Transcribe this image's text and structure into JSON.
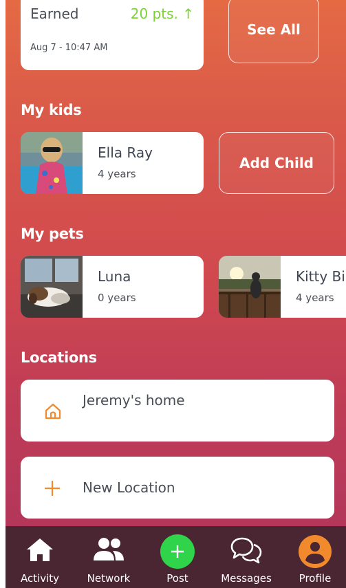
{
  "points": {
    "label": "Earned",
    "value": "20 pts. ↑",
    "timestamp": "Aug 7 - 10:47 AM",
    "see_all": "See All",
    "value_color": "#7ad234"
  },
  "kids": {
    "title": "My kids",
    "items": [
      {
        "name": "Ella Ray",
        "age": "4 years",
        "photo": "girl-sunglasses-pool-photo"
      }
    ],
    "add_label": "Add Child"
  },
  "pets": {
    "title": "My pets",
    "items": [
      {
        "name": "Luna",
        "age": "0 years",
        "photo": "dog-sleeping-photo"
      },
      {
        "name": "Kitty Bi",
        "age": "4 years",
        "photo": "cat-deck-sunset-photo"
      }
    ]
  },
  "locations": {
    "title": "Locations",
    "items": [
      {
        "name": "Jeremy's home",
        "icon": "home-outline-icon"
      }
    ],
    "new_label": "New Location",
    "accent": "#f08a2c"
  },
  "tabbar": {
    "background": "#4a2633",
    "items": [
      {
        "label": "Activity",
        "icon": "home-icon"
      },
      {
        "label": "Network",
        "icon": "people-icon"
      },
      {
        "label": "Post",
        "icon": "plus-circle-icon"
      },
      {
        "label": "Messages",
        "icon": "chat-bubbles-icon"
      },
      {
        "label": "Profile",
        "icon": "user-circle-icon"
      }
    ],
    "post_color": "#2fd44a",
    "profile_color": "#f08a2c"
  }
}
